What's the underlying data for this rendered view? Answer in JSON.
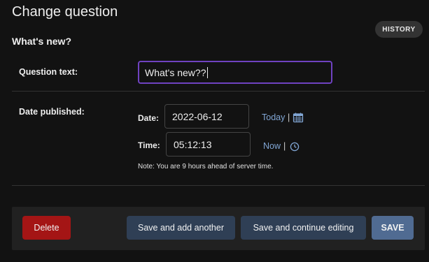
{
  "header": {
    "title": "Change question",
    "history_label": "HISTORY"
  },
  "fieldset": {
    "title": "What's new?"
  },
  "question_text": {
    "label": "Question text:",
    "value": "What's new??"
  },
  "date_published": {
    "label": "Date published:",
    "date_label": "Date:",
    "date_value": "2022-06-12",
    "today_link": "Today",
    "time_label": "Time:",
    "time_value": "05:12:13",
    "now_link": "Now",
    "separator": "|",
    "help_text": "Note: You are 9 hours ahead of server time."
  },
  "submit_row": {
    "delete_label": "Delete",
    "save_add_another_label": "Save and add another",
    "save_continue_label": "Save and continue editing",
    "save_label": "SAVE"
  },
  "icons": {
    "calendar": "calendar-icon",
    "clock": "clock-icon"
  },
  "colors": {
    "background": "#121212",
    "link": "#81a6d4",
    "focus_border": "#6f42c1",
    "delete": "#a41515",
    "secondary_button": "#2f3f55",
    "save_button": "#506b92"
  }
}
